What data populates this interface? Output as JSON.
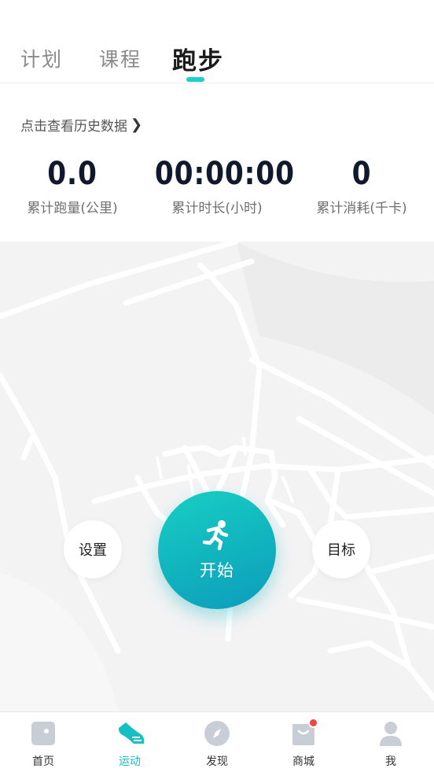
{
  "tabs": [
    {
      "label": "计划"
    },
    {
      "label": "课程"
    },
    {
      "label": "跑步",
      "active": true
    }
  ],
  "history_link": "点击查看历史数据",
  "stats": [
    {
      "value": "0.0",
      "label": "累计跑量(公里)"
    },
    {
      "value": "00:00:00",
      "label": "累计时长(小时)"
    },
    {
      "value": "0",
      "label": "累计消耗(千卡)"
    }
  ],
  "actions": {
    "settings_label": "设置",
    "start_label": "开始",
    "goal_label": "目标"
  },
  "bottom_nav": [
    {
      "label": "首页",
      "icon": "home-icon"
    },
    {
      "label": "运动",
      "icon": "shoe-icon",
      "active": true
    },
    {
      "label": "发现",
      "icon": "compass-icon"
    },
    {
      "label": "商城",
      "icon": "shopping-bag-icon",
      "badge": true
    },
    {
      "label": "我",
      "icon": "person-icon"
    }
  ],
  "colors": {
    "accent": "#16bfc4",
    "start_button": "#10b3be",
    "badge": "#f2453d",
    "map_background": "#f3f3f4"
  }
}
